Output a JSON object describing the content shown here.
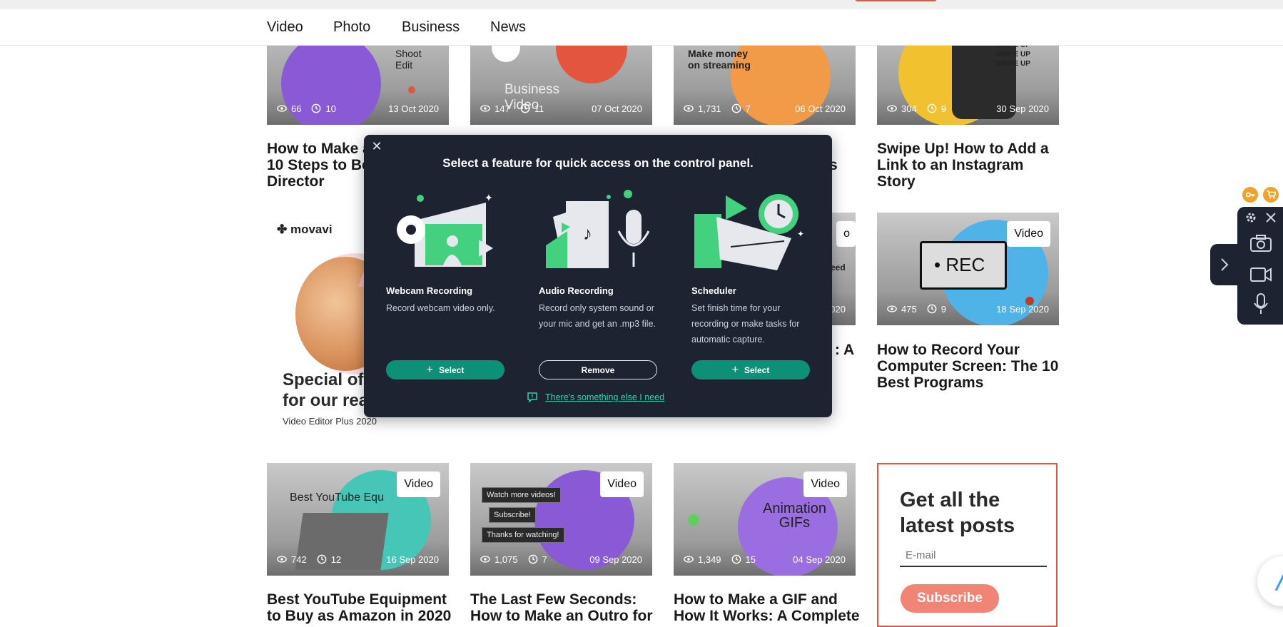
{
  "nav": {
    "items": [
      "Video",
      "Photo",
      "Business",
      "News"
    ]
  },
  "cards_row1": [
    {
      "tag": "",
      "views": "66",
      "comments": "10",
      "date": "13 Oct 2020",
      "title": "How to Make a\n10 Steps to Be\nDirector",
      "thumb_text": "Shoot\nEdit"
    },
    {
      "tag": "",
      "views": "147",
      "comments": "11",
      "date": "07 Oct 2020",
      "title": "",
      "thumb_text": "Business\nVideo"
    },
    {
      "tag": "",
      "views": "1,731",
      "comments": "7",
      "date": "06 Oct 2020",
      "title": "s",
      "thumb_text": "Make money\non streaming"
    },
    {
      "tag": "",
      "views": "304",
      "comments": "9",
      "date": "30 Sep 2020",
      "title": "Swipe Up! How to Add a\nLink to an Instagram\nStory",
      "thumb_text": "SWIPE UP\nSWIPE UP\nSWIPE UP"
    }
  ],
  "cards_row2": [
    {
      "tag": "o",
      "date": "020",
      "title": ": A",
      "thumb_text": "eed"
    },
    {
      "tag": "Video",
      "views": "475",
      "comments": "9",
      "date": "18 Sep 2020",
      "title": "How to Record Your\nComputer Screen: The 10\nBest Programs",
      "thumb_text": "• REC"
    }
  ],
  "promo": {
    "logo": "movavi",
    "headline": "Special of\nfor our rea",
    "sub": "Video Editor Plus 2020"
  },
  "cards_row3": [
    {
      "tag": "Video",
      "views": "742",
      "comments": "12",
      "date": "16 Sep 2020",
      "title": "Best YouTube Equipment\nto Buy as Amazon in 2020",
      "thumb_text": "Best YouTube Equ"
    },
    {
      "tag": "Video",
      "views": "1,075",
      "comments": "7",
      "date": "09 Sep 2020",
      "title": "The Last Few Seconds:\nHow to Make an Outro for",
      "thumb_text": "Watch more videos!|Subscribe!|Thanks for watching!"
    },
    {
      "tag": "Video",
      "views": "1,349",
      "comments": "15",
      "date": "04 Sep 2020",
      "title": "How to Make a GIF and\nHow It Works: A Complete",
      "thumb_text": "Animation\nGIFs"
    }
  ],
  "subscribe": {
    "title": "Get all the\nlatest posts",
    "email_placeholder": "E-mail",
    "button": "Subscribe"
  },
  "modal": {
    "title": "Select a feature for quick access on the control panel.",
    "features": [
      {
        "name": "Webcam Recording",
        "desc": "Record webcam video only.",
        "button": "Select",
        "button_style": "select"
      },
      {
        "name": "Audio Recording",
        "desc": "Record only system sound or your mic and get an .mp3 file.",
        "button": "Remove",
        "button_style": "remove"
      },
      {
        "name": "Scheduler",
        "desc": "Set finish time for your recording or make tasks for automatic capture.",
        "button": "Select",
        "button_style": "select"
      }
    ],
    "feedback_link": "There's something else I need"
  },
  "colors": {
    "accent_green": "#0e8f78",
    "modal_bg": "#1d2331",
    "brand_red": "#e4553f",
    "link_teal": "#35d0b2"
  },
  "control_panel": {
    "icons": [
      "key-icon",
      "cart-icon",
      "gear-icon",
      "close-icon",
      "chevron-right-icon",
      "camera-icon",
      "video-camera-icon",
      "microphone-icon"
    ]
  }
}
